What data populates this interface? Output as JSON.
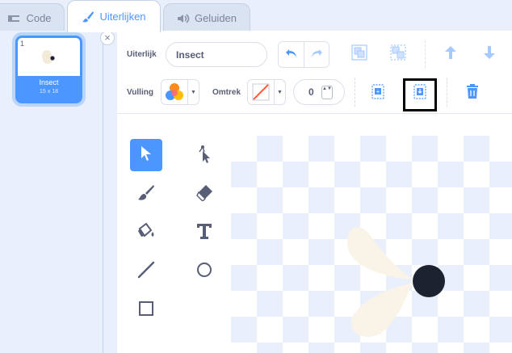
{
  "tabs": [
    {
      "label": "Code",
      "icon": "code-icon"
    },
    {
      "label": "Uiterlijken",
      "icon": "brush-icon",
      "active": true
    },
    {
      "label": "Geluiden",
      "icon": "speaker-icon"
    }
  ],
  "costume_list": {
    "items": [
      {
        "number": "1",
        "name": "Insect",
        "size": "15 x 18",
        "selected": true
      }
    ],
    "close_symbol": "×"
  },
  "editor": {
    "costume_label": "Uiterlijk",
    "costume_name": "Insect",
    "fill_label": "Vulling",
    "outline_label": "Omtrek",
    "outline_width": "0",
    "stepper_symbols": "▲▼"
  },
  "colors": {
    "accent": "#4c97ff",
    "text": "#575e75",
    "highlight_border": "#000000",
    "sprite_wing": "#faf3e8",
    "sprite_body": "#1c222f",
    "outline_slash": "#ff5d3b"
  },
  "tools": [
    "select-tool",
    "reshape-tool",
    "brush-tool",
    "eraser-tool",
    "fill-tool",
    "text-tool",
    "line-tool",
    "circle-tool",
    "rectangle-tool"
  ]
}
